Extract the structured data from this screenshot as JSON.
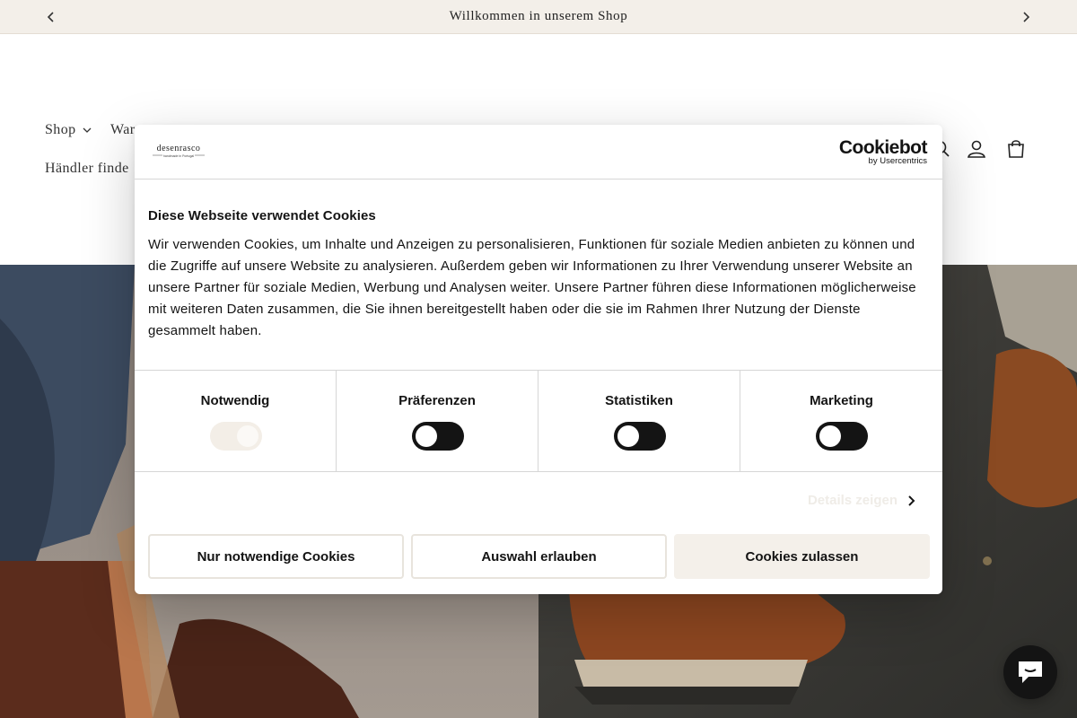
{
  "announcement": {
    "text": "Willkommen in unserem Shop"
  },
  "header": {
    "nav": {
      "shop": "Shop",
      "war": "War",
      "haendler": "Händler finde"
    },
    "icons": [
      "search-icon",
      "account-icon",
      "cart-icon"
    ]
  },
  "cookie_dialog": {
    "brand_logo_text": "desenrasco",
    "brand_logo_subtext": "handmade in Portugal",
    "provider_logo": "Cookiebot",
    "provider_sub": "by Usercentrics",
    "title": "Diese Webseite verwendet Cookies",
    "description": "Wir verwenden Cookies, um Inhalte und Anzeigen zu personalisieren, Funktionen für soziale Medien anbieten zu können und die Zugriffe auf unsere Website zu analysieren. Außerdem geben wir Informationen zu Ihrer Verwendung unserer Website an unsere Partner für soziale Medien, Werbung und Analysen weiter. Unsere Partner führen diese Informationen möglicherweise mit weiteren Daten zusammen, die Sie ihnen bereitgestellt haben oder die sie im Rahmen Ihrer Nutzung der Dienste gesammelt haben.",
    "categories": [
      {
        "label": "Notwendig",
        "checked": true,
        "disabled": true
      },
      {
        "label": "Präferenzen",
        "checked": false,
        "disabled": false
      },
      {
        "label": "Statistiken",
        "checked": false,
        "disabled": false
      },
      {
        "label": "Marketing",
        "checked": false,
        "disabled": false
      }
    ],
    "details_link": "Details zeigen",
    "buttons": {
      "necessary_only": "Nur notwendige Cookies",
      "allow_selection": "Auswahl erlauben",
      "allow_all": "Cookies zulassen"
    }
  },
  "colors": {
    "announcement_bg": "#f3efe9",
    "dark": "#141414",
    "accent_light": "#f4f0ea"
  }
}
